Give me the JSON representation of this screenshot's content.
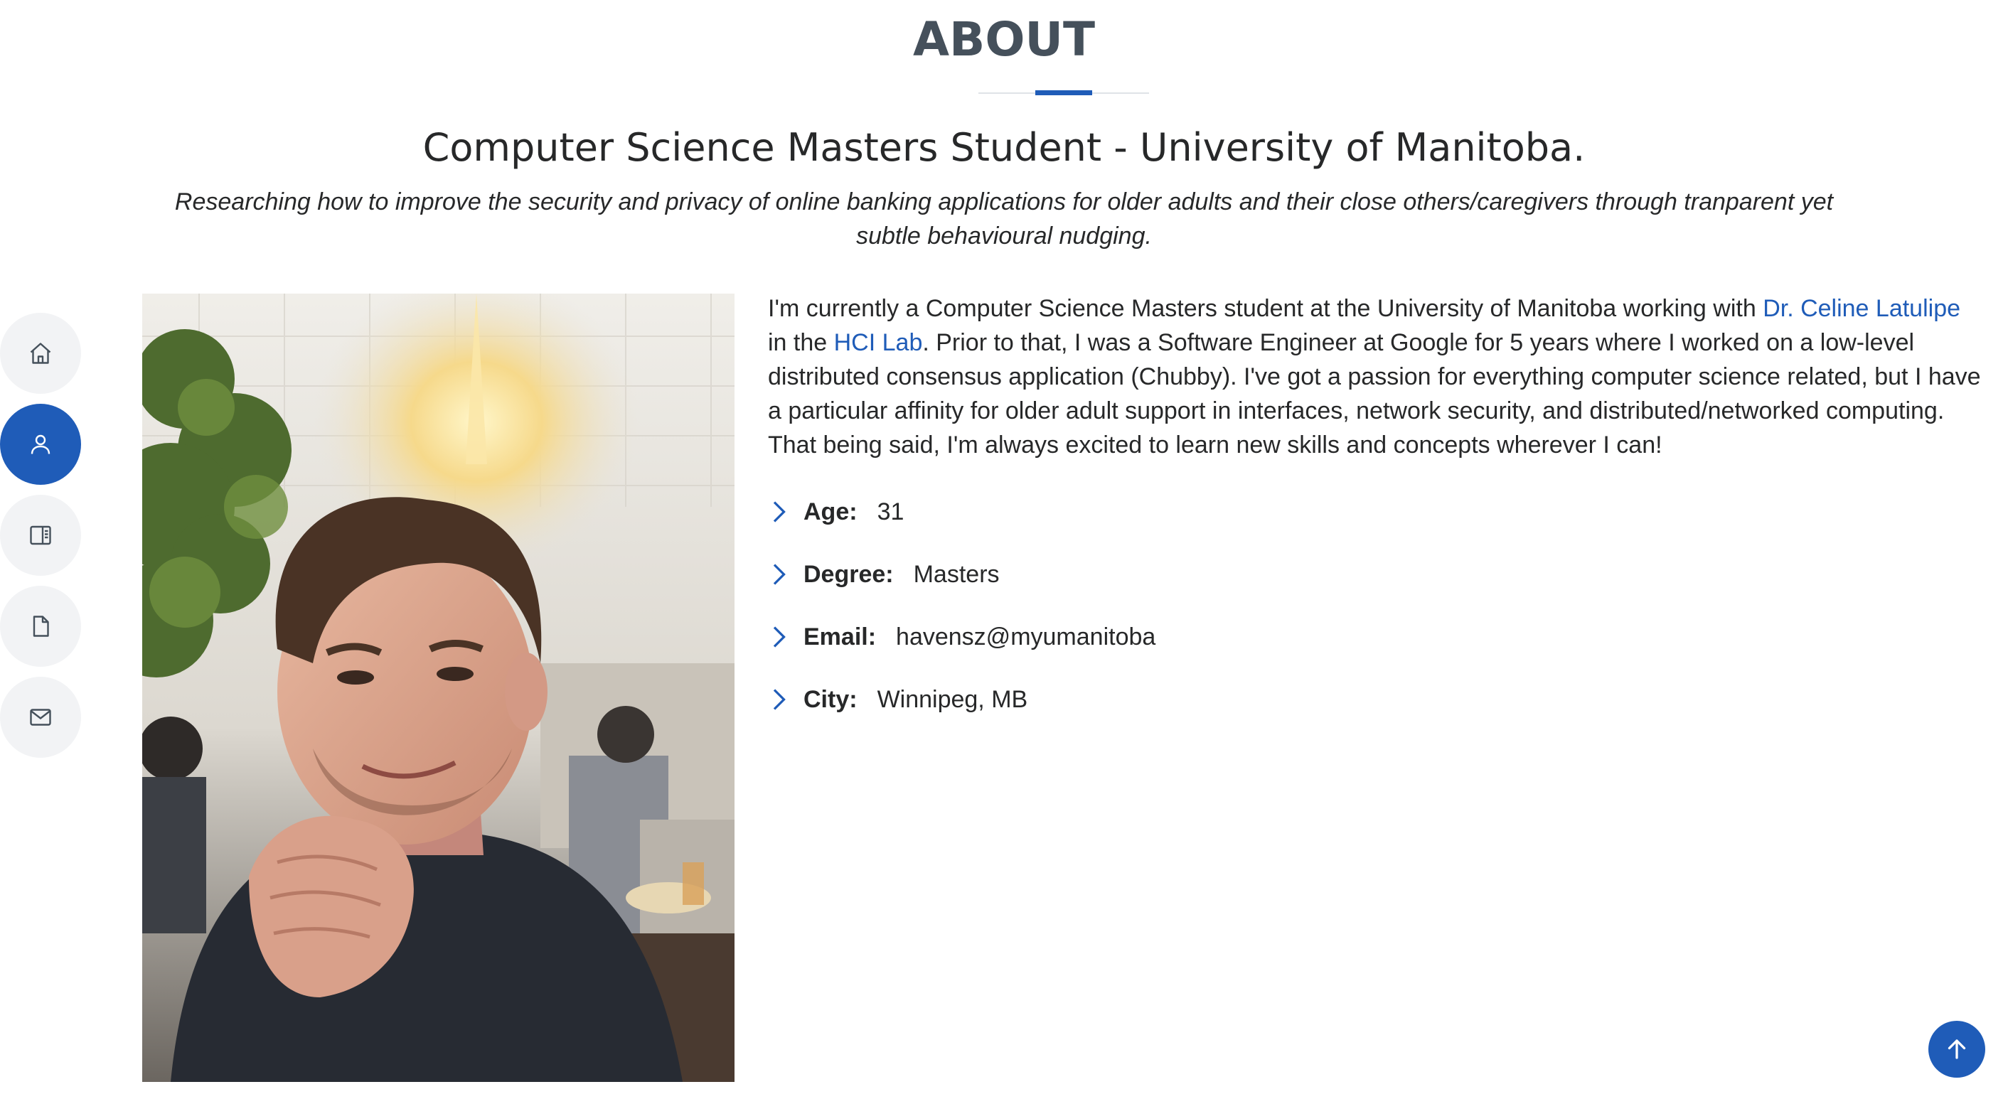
{
  "section": {
    "title": "ABOUT",
    "headline": "Computer Science Masters Student - University of Manitoba.",
    "tagline": "Researching how to improve the security and privacy of online banking applications for older adults and their close others/caregivers through tranparent yet subtle behavioural nudging."
  },
  "nav": {
    "items": [
      {
        "icon": "home-icon",
        "active": false
      },
      {
        "icon": "person-icon",
        "active": true
      },
      {
        "icon": "book-icon",
        "active": false
      },
      {
        "icon": "file-icon",
        "active": false
      },
      {
        "icon": "envelope-icon",
        "active": false
      }
    ]
  },
  "bio": {
    "part1": "I'm currently a Computer Science Masters student at the University of Manitoba working with ",
    "link1": "Dr. Celine Latulipe",
    "part2": " in the ",
    "link2": "HCI Lab",
    "part3": ". Prior to that, I was a Software Engineer at Google for 5 years where I worked on a low-level distributed consensus application (Chubby). I've got a passion for everything computer science related, but I have a particular affinity for older adult support in interfaces, network security, and distributed/networked computing. That being said, I'm always excited to learn new skills and concepts wherever I can!"
  },
  "facts": [
    {
      "label": "Age:",
      "value": "31"
    },
    {
      "label": "Degree:",
      "value": "Masters"
    },
    {
      "label": "Email:",
      "value": "havensz@myumanitoba"
    },
    {
      "label": "City:",
      "value": "Winnipeg, MB"
    }
  ],
  "colors": {
    "accent": "#1f5cb8",
    "heading": "#45505b",
    "text": "#272829",
    "nav_bg": "#f2f3f5"
  },
  "back_to_top": {
    "icon": "arrow-up-icon"
  }
}
